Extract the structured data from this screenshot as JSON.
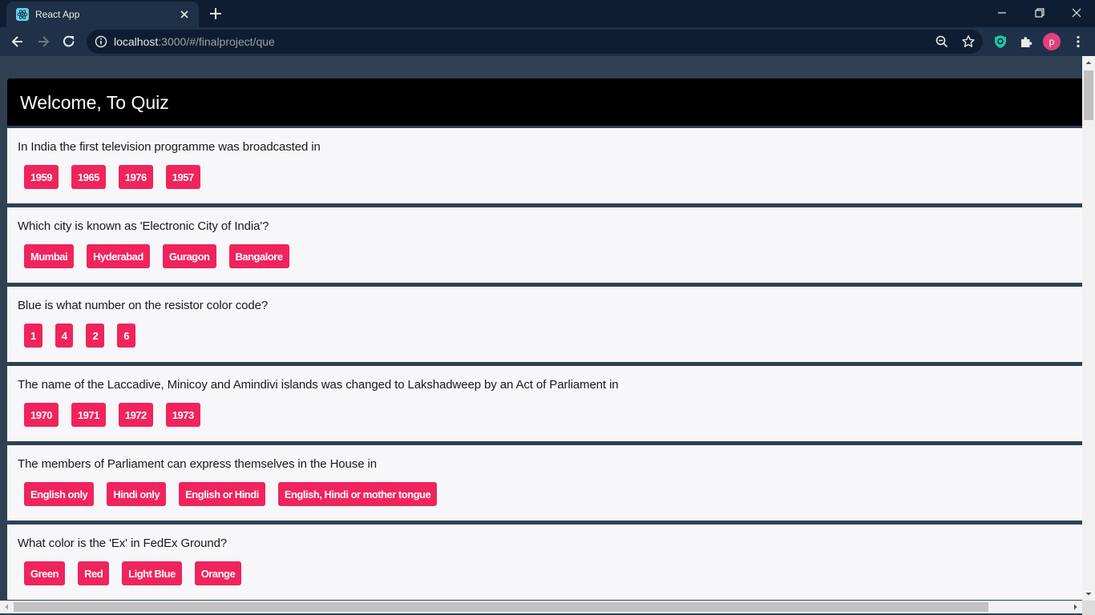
{
  "browser": {
    "tab_title": "React App",
    "url_host": "localhost",
    "url_rest": ":3000/#/finalproject/que",
    "profile_initial": "p"
  },
  "page": {
    "title": "Welcome, To Quiz",
    "accent_color": "#f0245d",
    "questions": [
      {
        "text": "In India the first television programme was broadcasted in",
        "options": [
          "1959",
          "1965",
          "1976",
          "1957"
        ]
      },
      {
        "text": "Which city is known as 'Electronic City of India'?",
        "options": [
          "Mumbai",
          "Hyderabad",
          "Guragon",
          "Bangalore"
        ]
      },
      {
        "text": "Blue is what number on the resistor color code?",
        "options": [
          "1",
          "4",
          "2",
          "6"
        ]
      },
      {
        "text": "The name of the Laccadive, Minicoy and Amindivi islands was changed to Lakshadweep by an Act of Parliament in",
        "options": [
          "1970",
          "1971",
          "1972",
          "1973"
        ]
      },
      {
        "text": "The members of Parliament can express themselves in the House in",
        "options": [
          "English only",
          "Hindi only",
          "English or Hindi",
          "English, Hindi or mother tongue"
        ]
      },
      {
        "text": "What color is the 'Ex' in FedEx Ground?",
        "options": [
          "Green",
          "Red",
          "Light Blue",
          "Orange"
        ]
      }
    ]
  }
}
